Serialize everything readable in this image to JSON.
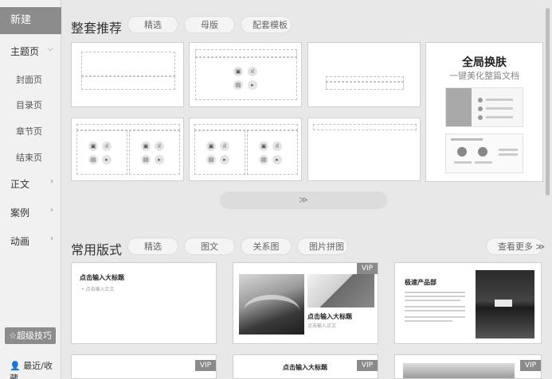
{
  "sidebar": {
    "new_label": "新建",
    "items": [
      {
        "label": "主题页",
        "chevron": "⌵"
      },
      {
        "label": "正文",
        "chevron": "›"
      },
      {
        "label": "案例",
        "chevron": "›"
      },
      {
        "label": "动画",
        "chevron": "›"
      }
    ],
    "sub_items": [
      "封面页",
      "目录页",
      "章节页",
      "结束页"
    ],
    "tips_label": "超级技巧",
    "recent_label": "最近/收藏"
  },
  "section1": {
    "title": "整套推荐",
    "tabs": [
      "精选",
      "母版",
      "配套模板"
    ]
  },
  "skin_card": {
    "title": "全局换肤",
    "subtitle": "一键美化整篇文档"
  },
  "section2": {
    "title": "常用版式",
    "tabs": [
      "精选",
      "图文",
      "关系图",
      "图片拼图"
    ],
    "more_label": "查看更多 ≫"
  },
  "layout_cards": {
    "card1": {
      "title": "点击输入大标题",
      "sub": "• 点击输入正文"
    },
    "card2": {
      "badge": "VIP",
      "title": "点击输入大标题",
      "sub": "点击输入正文"
    },
    "card3": {
      "title": "极速产品部"
    },
    "card4": {
      "badge": "VIP"
    },
    "card5": {
      "badge": "VIP",
      "title": "点击输入大标题"
    },
    "card6": {
      "badge": "VIP"
    }
  },
  "icons": {
    "expand": "double-chevron-down-icon",
    "star": "star-icon",
    "user": "user-icon"
  }
}
